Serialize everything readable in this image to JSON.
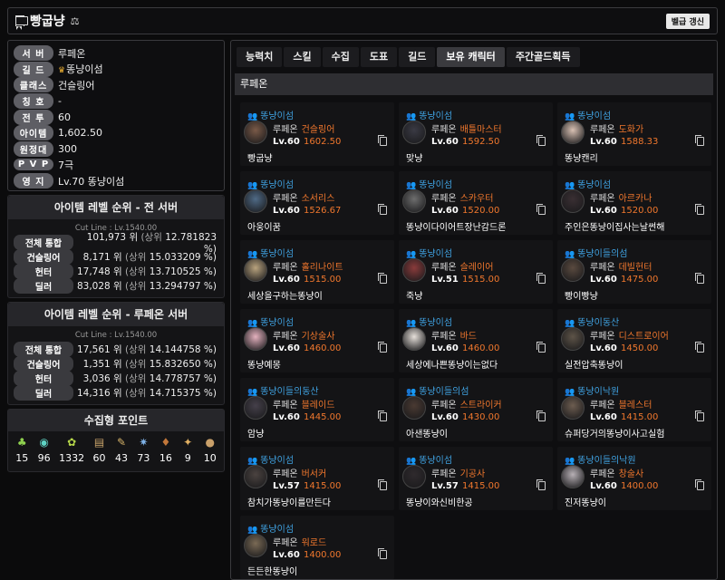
{
  "header": {
    "title": "빵굽냥",
    "refresh_label": "벨급 갱신"
  },
  "profile": [
    {
      "label": "서 버",
      "value": "루페온"
    },
    {
      "label": "길 드",
      "value": "똥냥이섬",
      "crown": true
    },
    {
      "label": "클래스",
      "value": "건슬링어"
    },
    {
      "label": "칭 호",
      "value": "-"
    },
    {
      "label": "전 투",
      "value": "60"
    },
    {
      "label": "아이템",
      "value": "1,602.50"
    },
    {
      "label": "원정대",
      "value": "300"
    },
    {
      "label": "P V P",
      "value": "7극"
    },
    {
      "label": "영 지",
      "value": "Lv.70 똥냥이섬"
    }
  ],
  "rank_all": {
    "title": "아이템 레벨 순위 - 전 서버",
    "cutline": "Cut Line : Lv.1540.00",
    "rows": [
      {
        "label": "전체 통합",
        "rank": "101,973 위",
        "pct": "12.781823 %)"
      },
      {
        "label": "건슬링어",
        "rank": "8,171 위",
        "pct": "15.033209 %)"
      },
      {
        "label": "헌터",
        "rank": "17,748 위",
        "pct": "13.710525 %)"
      },
      {
        "label": "딜러",
        "rank": "83,028 위",
        "pct": "13.294797 %)"
      }
    ]
  },
  "rank_server": {
    "title": "아이템 레벨 순위 - 루페온 서버",
    "cutline": "Cut Line : Lv.1540.00",
    "rows": [
      {
        "label": "전체 통합",
        "rank": "17,561 위",
        "pct": "14.144758 %)"
      },
      {
        "label": "건슬링어",
        "rank": "1,351 위",
        "pct": "15.832650 %)"
      },
      {
        "label": "헌터",
        "rank": "3,036 위",
        "pct": "14.778757 %)"
      },
      {
        "label": "딜러",
        "rank": "14,316 위",
        "pct": "14.715375 %)"
      }
    ]
  },
  "rank_prefix": "(상위",
  "collection": {
    "title": "수집형 포인트",
    "items": [
      {
        "icon": "mokoko-seed-icon",
        "glyph": "♣",
        "color": "#8fd14f",
        "count": "15"
      },
      {
        "icon": "island-heart-icon",
        "glyph": "◉",
        "color": "#5fd3c4",
        "count": "96"
      },
      {
        "icon": "mokoko-icon",
        "glyph": "✿",
        "color": "#b7d84a",
        "count": "1332"
      },
      {
        "icon": "masterpiece-icon",
        "glyph": "▤",
        "color": "#c9a36a",
        "count": "60"
      },
      {
        "icon": "adventure-icon",
        "glyph": "✎",
        "color": "#d7b46a",
        "count": "43"
      },
      {
        "icon": "star-icon",
        "glyph": "✷",
        "color": "#7fb2e6",
        "count": "73"
      },
      {
        "icon": "giant-heart-icon",
        "glyph": "♦",
        "color": "#c2773a",
        "count": "16"
      },
      {
        "icon": "ignea-icon",
        "glyph": "✦",
        "color": "#e1b062",
        "count": "9"
      },
      {
        "icon": "orpheus-icon",
        "glyph": "●",
        "color": "#c9a06a",
        "count": "10"
      }
    ]
  },
  "tabs": [
    "능력치",
    "스킬",
    "수집",
    "도표",
    "길드",
    "보유 캐릭터",
    "주간골드획득"
  ],
  "active_tab": 5,
  "server_bar": "루페온",
  "characters": [
    {
      "guild": "똥냥이섬",
      "server": "루페온",
      "class": "건슬링어",
      "lv": "Lv.60",
      "ilvl": "1602.50",
      "name": "빵굽냥",
      "avatar": "#7a5a48"
    },
    {
      "guild": "똥냥이섬",
      "server": "루페온",
      "class": "배틀마스터",
      "lv": "Lv.60",
      "ilvl": "1592.50",
      "name": "맞냥",
      "avatar": "#3a3a44"
    },
    {
      "guild": "똥냥이섬",
      "server": "루페온",
      "class": "도화가",
      "lv": "Lv.60",
      "ilvl": "1588.33",
      "name": "똥냥캔리",
      "avatar": "#d9c1b3"
    },
    {
      "guild": "똥냥이섬",
      "server": "루페온",
      "class": "소서리스",
      "lv": "Lv.60",
      "ilvl": "1526.67",
      "name": "아웅이꿈",
      "avatar": "#4f6a86"
    },
    {
      "guild": "똥냥이섬",
      "server": "루페온",
      "class": "스카우터",
      "lv": "Lv.60",
      "ilvl": "1520.00",
      "name": "똥냥이다이어트장난감드론",
      "avatar": "#6e6e6e"
    },
    {
      "guild": "똥냥이섬",
      "server": "루페온",
      "class": "아르카나",
      "lv": "Lv.60",
      "ilvl": "1520.00",
      "name": "주인은똥냥이집사는날썬해",
      "avatar": "#3a2f33"
    },
    {
      "guild": "똥냥이섬",
      "server": "루페온",
      "class": "홀리나이트",
      "lv": "Lv.60",
      "ilvl": "1515.00",
      "name": "세상을구하는똥냥이",
      "avatar": "#b9a37e"
    },
    {
      "guild": "똥냥이섬",
      "server": "루페온",
      "class": "슬레이어",
      "lv": "Lv.51",
      "ilvl": "1515.00",
      "name": "죽냥",
      "avatar": "#8a3b3b"
    },
    {
      "guild": "똥냥이들의섬",
      "server": "루페온",
      "class": "데빌헌터",
      "lv": "Lv.60",
      "ilvl": "1475.00",
      "name": "빵이빵냥",
      "avatar": "#5a4a3f"
    },
    {
      "guild": "똥냥이섬",
      "server": "루페온",
      "class": "기상술사",
      "lv": "Lv.60",
      "ilvl": "1460.00",
      "name": "똥냥예몽",
      "avatar": "#e4b1be"
    },
    {
      "guild": "똥냥이섬",
      "server": "루페온",
      "class": "바드",
      "lv": "Lv.60",
      "ilvl": "1460.00",
      "name": "세상에나쁜똥냥이는없다",
      "avatar": "#e6e0da"
    },
    {
      "guild": "똥냥이동산",
      "server": "루페온",
      "class": "디스트로이어",
      "lv": "Lv.60",
      "ilvl": "1450.00",
      "name": "실전압축똥냥이",
      "avatar": "#5e5448"
    },
    {
      "guild": "똥냥이들의동산",
      "server": "루페온",
      "class": "블레이드",
      "lv": "Lv.60",
      "ilvl": "1445.00",
      "name": "암냥",
      "avatar": "#45404a"
    },
    {
      "guild": "똥냥이들의섬",
      "server": "루페온",
      "class": "스트라이커",
      "lv": "Lv.60",
      "ilvl": "1430.00",
      "name": "아샌똥냥이",
      "avatar": "#4a3a32"
    },
    {
      "guild": "똥냥이낙원",
      "server": "루페온",
      "class": "블레스터",
      "lv": "Lv.60",
      "ilvl": "1415.00",
      "name": "슈퍼당거의똥냥이사고실험",
      "avatar": "#6d5d50"
    },
    {
      "guild": "똥냥이섬",
      "server": "루페온",
      "class": "버서커",
      "lv": "Lv.57",
      "ilvl": "1415.00",
      "name": "참치가똥냥이를만든다",
      "avatar": "#4b4340"
    },
    {
      "guild": "똥냥이섬",
      "server": "루페온",
      "class": "기공사",
      "lv": "Lv.57",
      "ilvl": "1415.00",
      "name": "똥냥이와신비한공",
      "avatar": "#2f2a2d"
    },
    {
      "guild": "똥냥이들의낙원",
      "server": "루페온",
      "class": "창술사",
      "lv": "Lv.60",
      "ilvl": "1400.00",
      "name": "진저똥냥이",
      "avatar": "#b7b0b5"
    },
    {
      "guild": "똥냥이섬",
      "server": "루페온",
      "class": "워로드",
      "lv": "Lv.60",
      "ilvl": "1400.00",
      "name": "든든한똥냥이",
      "avatar": "#7a6a55"
    }
  ]
}
